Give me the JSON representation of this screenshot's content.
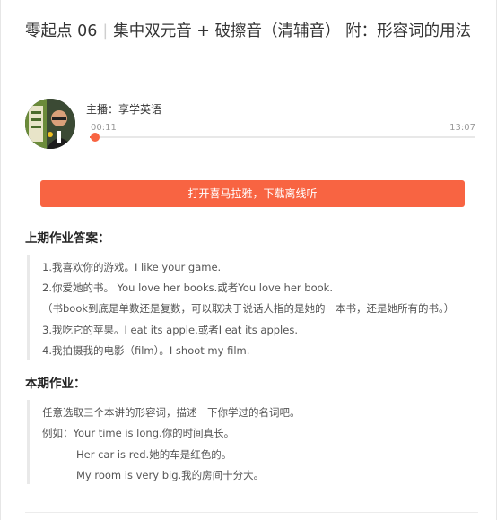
{
  "header": {
    "title_part1": "零起点 06",
    "title_part2": "集中双元音 + 破擦音（清辅音） 附：形容词的用法"
  },
  "player": {
    "host": "主播：享学英语",
    "current_time": "00:11",
    "total_time": "13:07",
    "progress": 0.014,
    "accent_color": "#f86442"
  },
  "cta": {
    "label": "打开喜马拉雅，下载离线听"
  },
  "last_homework": {
    "heading": "上期作业答案：",
    "lines": [
      "1.我喜欢你的游戏。I like your game.",
      "2.你爱她的书。 You love her books.或者You love her book.",
      "（书book到底是单数还是复数，可以取决于说话人指的是她的一本书，还是她所有的书。）",
      "3.我吃它的苹果。I eat its apple.或者I eat its apples.",
      "4.我拍摄我的电影（film）。I shoot my film."
    ]
  },
  "this_homework": {
    "heading": "本期作业：",
    "lines": [
      "任意选取三个本讲的形容词，描述一下你学过的名词吧。",
      "例如：Your time is long.你的时间真长。",
      "Her car is red.她的车是红色的。",
      "My room is very big.我的房间十分大。"
    ]
  }
}
